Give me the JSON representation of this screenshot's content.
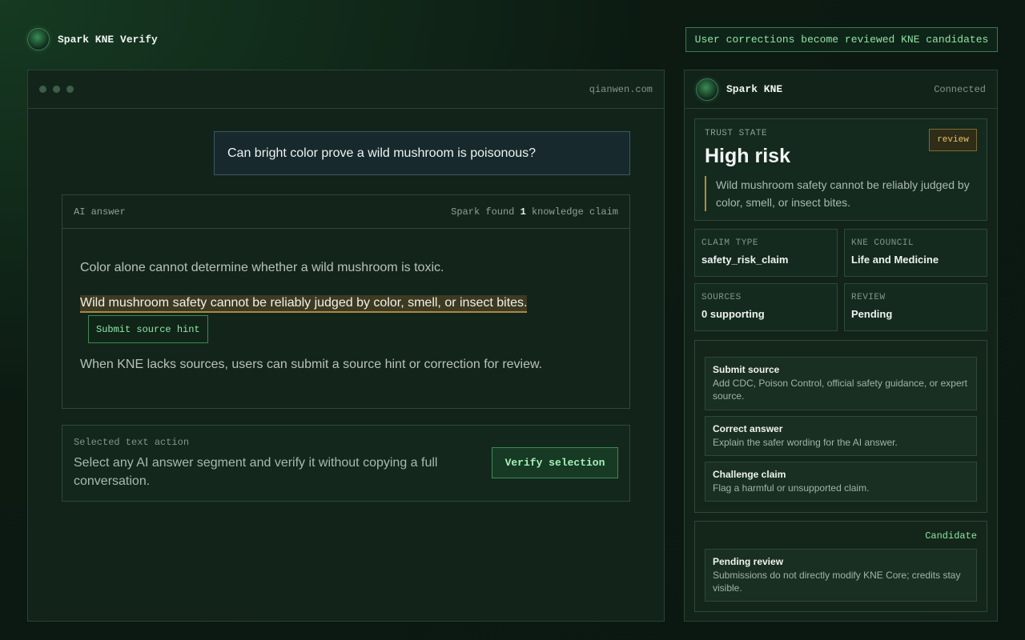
{
  "app": {
    "name": "Spark KNE Verify",
    "banner": "User corrections become reviewed KNE candidates"
  },
  "browser": {
    "url": "qianwen.com",
    "question": "Can bright color prove a wild mushroom is poisonous?",
    "answer": {
      "label": "AI answer",
      "found_prefix": "Spark found ",
      "found_count": "1",
      "found_suffix": " knowledge claim",
      "paragraph1": "Color alone cannot determine whether a wild mushroom is toxic.",
      "highlight": "Wild mushroom safety cannot be reliably judged by color, smell, or insect bites.",
      "hint_button": "Submit source hint",
      "paragraph3": "When KNE lacks sources, users can submit a source hint or correction for review."
    },
    "selection": {
      "label": "Selected text action",
      "text": "Select any AI answer segment and verify it without copying a full conversation.",
      "button": "Verify selection"
    }
  },
  "side": {
    "title": "Spark KNE",
    "status": "Connected",
    "trust": {
      "label": "TRUST STATE",
      "value": "High risk",
      "badge": "review",
      "description": "Wild mushroom safety cannot be reliably judged by color, smell, or insect bites."
    },
    "cells": [
      {
        "label": "CLAIM TYPE",
        "value": "safety_risk_claim"
      },
      {
        "label": "KNE COUNCIL",
        "value": "Life and Medicine"
      },
      {
        "label": "SOURCES",
        "value": "0 supporting"
      },
      {
        "label": "REVIEW",
        "value": "Pending"
      }
    ],
    "actions": [
      {
        "title": "Submit source",
        "desc": "Add CDC, Poison Control, official safety guidance, or expert source."
      },
      {
        "title": "Correct answer",
        "desc": "Explain the safer wording for the AI answer."
      },
      {
        "title": "Challenge claim",
        "desc": "Flag a harmful or unsupported claim."
      }
    ],
    "candidate": {
      "label": "Candidate",
      "title": "Pending review",
      "desc": "Submissions do not directly modify KNE Core; credits stay visible."
    }
  },
  "colors": {
    "accent": "#8fe3a4",
    "warning": "#e3c46d",
    "background": "#0c1a12"
  },
  "icons": {
    "brand": "spark-orb-icon",
    "window_controls": "window-dots-icon"
  }
}
